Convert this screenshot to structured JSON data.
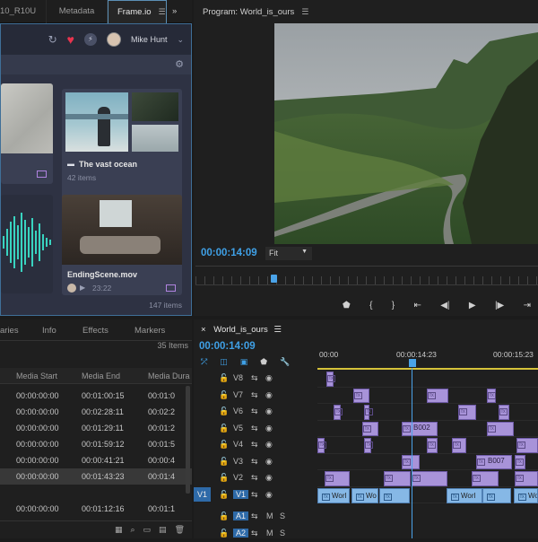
{
  "left_tabs": [
    "10_R10U",
    "Metadata",
    "Frame.io"
  ],
  "frameio": {
    "user": "Mike Hunt",
    "cards": [
      {
        "title": "The vast ocean",
        "subtitle": "42 items"
      },
      {
        "title": "EndingScene.mov",
        "subtitle": "23:22"
      }
    ],
    "item_count": "147 items"
  },
  "program": {
    "title": "Program: World_is_ours",
    "timecode": "00:00:14:09",
    "fit": "Fit"
  },
  "project": {
    "tabs": [
      "aries",
      "Info",
      "Effects",
      "Markers"
    ],
    "count": "35 Items",
    "columns": [
      "Media Start",
      "Media End",
      "Media Dura"
    ],
    "rows": [
      [
        "00:00:00:00",
        "00:01:00:15",
        "00:01:0"
      ],
      [
        "00:00:00:00",
        "00:02:28:11",
        "00:02:2"
      ],
      [
        "00:00:00:00",
        "00:01:29:11",
        "00:01:2"
      ],
      [
        "00:00:00:00",
        "00:01:59:12",
        "00:01:5"
      ],
      [
        "00:00:00:00",
        "00:00:41:21",
        "00:00:4"
      ],
      [
        "00:00:00:00",
        "00:01:43:23",
        "00:01:4"
      ],
      [
        "",
        "",
        ""
      ],
      [
        "00:00:00:00",
        "00:01:12:16",
        "00:01:1"
      ]
    ]
  },
  "timeline": {
    "title": "World_is_ours",
    "timecode": "00:00:14:09",
    "ruler": [
      "00:00",
      "00:00:14:23",
      "00:00:15:23"
    ],
    "video_tracks": [
      "V8",
      "V7",
      "V6",
      "V5",
      "V4",
      "V3",
      "V2",
      "V1"
    ],
    "audio_tracks": [
      "A1",
      "A2"
    ],
    "source_patch": "V1",
    "mute": "M",
    "solo": "S",
    "clip_labels": [
      "B002",
      "B007"
    ],
    "audio_clip_labels": [
      "Worl",
      "Wo",
      "Worl",
      "World"
    ]
  }
}
